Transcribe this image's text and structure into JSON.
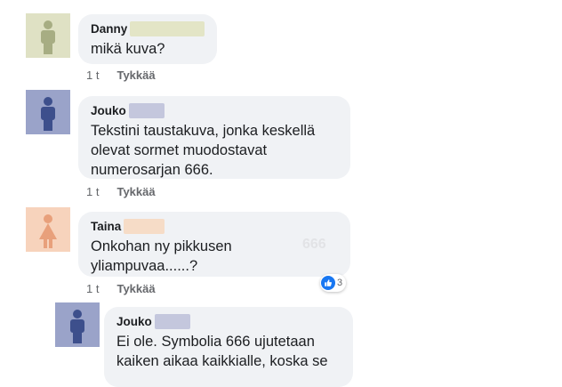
{
  "comments": [
    {
      "name": "Danny",
      "text": "mikä kuva?",
      "time": "1 t",
      "like_label": "Tykkää",
      "avatar_color": "#a7ad83",
      "redact_color": "#e3e5c6"
    },
    {
      "name": "Jouko",
      "text": "Tekstini taustakuva, jonka keskellä\nolevat sormet muodostavat\nnumerosarjan 666.",
      "time": "1 t",
      "like_label": "Tykkää",
      "avatar_color": "#3d4f8c",
      "redact_color": "#c4c7dd"
    },
    {
      "name": "Taina",
      "text": "Onkohan ny pikkusen\nyliampuvaa......?",
      "time": "1 t",
      "like_label": "Tykkää",
      "avatar_color": "#e8a07b",
      "redact_color": "#f6dcc7",
      "faint_text": "666",
      "reactions": {
        "icon": "thumbs-up-icon",
        "count": "3"
      }
    },
    {
      "name": "Jouko",
      "text": "Ei ole. Symbolia 666 ujutetaan\nkaiken aikaa kaikkialle, koska se",
      "avatar_color": "#3d4f8c",
      "redact_color": "#c4c7dd"
    }
  ]
}
